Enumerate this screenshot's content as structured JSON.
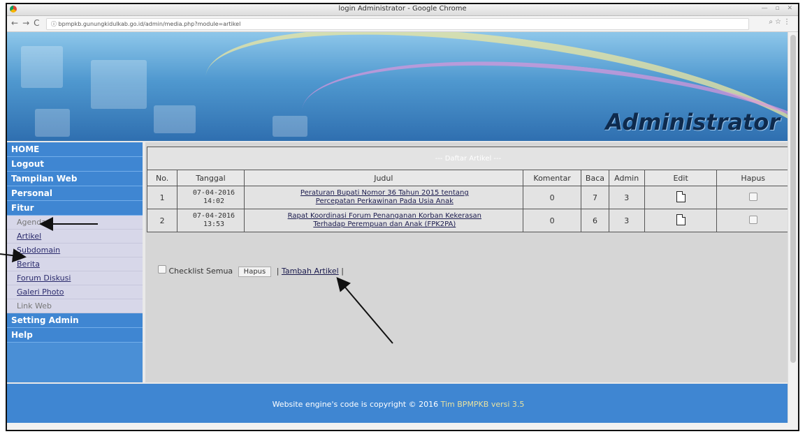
{
  "window": {
    "title": "login Administrator - Google Chrome"
  },
  "browser": {
    "url": "bpmpkb.gunungkidulkab.go.id/admin/media.php?module=artikel"
  },
  "banner": {
    "title": "Administrator"
  },
  "sidebar": {
    "items": [
      {
        "label": "HOME"
      },
      {
        "label": "Logout"
      },
      {
        "label": "Tampilan Web"
      },
      {
        "label": "Personal"
      },
      {
        "label": "Fitur"
      }
    ],
    "fitur_sub": [
      {
        "label": "Agenda",
        "style": "plain"
      },
      {
        "label": "Artikel",
        "style": "link"
      },
      {
        "label": "Subdomain",
        "style": "link"
      },
      {
        "label": "Berita",
        "style": "link"
      },
      {
        "label": "Forum Diskusi",
        "style": "link"
      },
      {
        "label": "Galeri Photo",
        "style": "link"
      },
      {
        "label": "Link Web",
        "style": "plain"
      }
    ],
    "bottom_items": [
      {
        "label": "Setting Admin"
      },
      {
        "label": "Help"
      }
    ]
  },
  "table": {
    "caption": "--- Daftar Artikel ---",
    "headers": [
      "No.",
      "Tanggal",
      "Judul",
      "Komentar",
      "Baca",
      "Admin",
      "Edit",
      "Hapus"
    ],
    "rows": [
      {
        "no": "1",
        "tanggal_date": "07-04-2016",
        "tanggal_time": "14:02",
        "judul_1": "Peraturan Bupati Nomor 36 Tahun 2015 tentang",
        "judul_2": "Percepatan Perkawinan Pada Usia Anak",
        "komentar": "0",
        "baca": "7",
        "admin": "3"
      },
      {
        "no": "2",
        "tanggal_date": "07-04-2016",
        "tanggal_time": "13:53",
        "judul_1": "Rapat Koordinasi Forum Penanganan Korban Kekerasan",
        "judul_2": "Terhadap Perempuan dan Anak (FPK2PA)",
        "komentar": "0",
        "baca": "6",
        "admin": "3"
      }
    ]
  },
  "actions": {
    "checklist": "Checklist Semua",
    "hapus": "Hapus",
    "sep1": "|",
    "tambah": "Tambah Artikel",
    "sep2": "|"
  },
  "footer": {
    "text": "Website engine's code is copyright © 2016",
    "team": "Tim BPMPKB",
    "version": "versi 3.5"
  }
}
